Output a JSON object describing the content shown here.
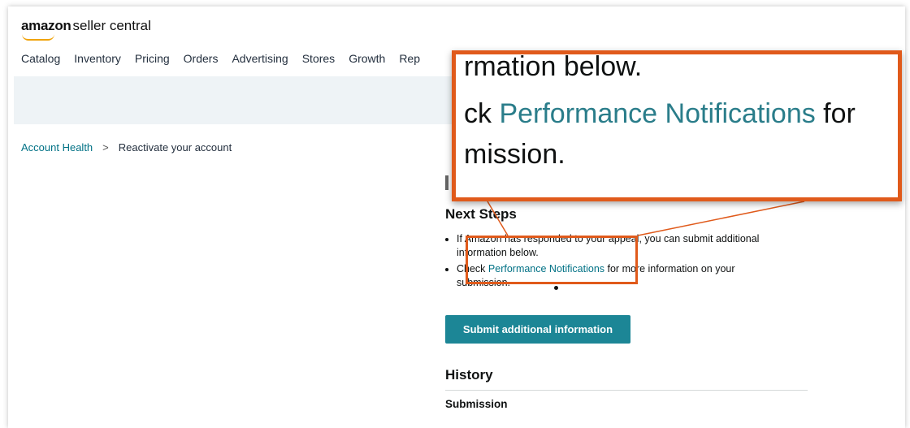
{
  "header": {
    "logo_brand": "amazon",
    "logo_sub": "seller central",
    "nav_items": [
      "Catalog",
      "Inventory",
      "Pricing",
      "Orders",
      "Advertising",
      "Stores",
      "Growth",
      "Rep"
    ]
  },
  "breadcrumb": {
    "parent": "Account Health",
    "separator": ">",
    "current": "Reactivate your account"
  },
  "next_steps": {
    "heading": "Next Steps",
    "item1_text": "If Amazon has responded to your appeal, you can submit additional information below.",
    "item2_prefix": "Check ",
    "item2_link": "Performance Notifications",
    "item2_suffix": " for more information on your submission."
  },
  "submit_button_label": "Submit additional information",
  "history": {
    "heading": "History",
    "subheading": "Submission"
  },
  "zoom_callout": {
    "line1": "rmation below.",
    "line2_prefix": "ck ",
    "line2_link": "Performance Notifications",
    "line2_suffix": " for",
    "line3": "mission."
  },
  "colors": {
    "accent_orange": "#e05a1b",
    "link_teal": "#007185",
    "button_teal": "#1c8696",
    "banner_bg": "#eef3f6"
  }
}
